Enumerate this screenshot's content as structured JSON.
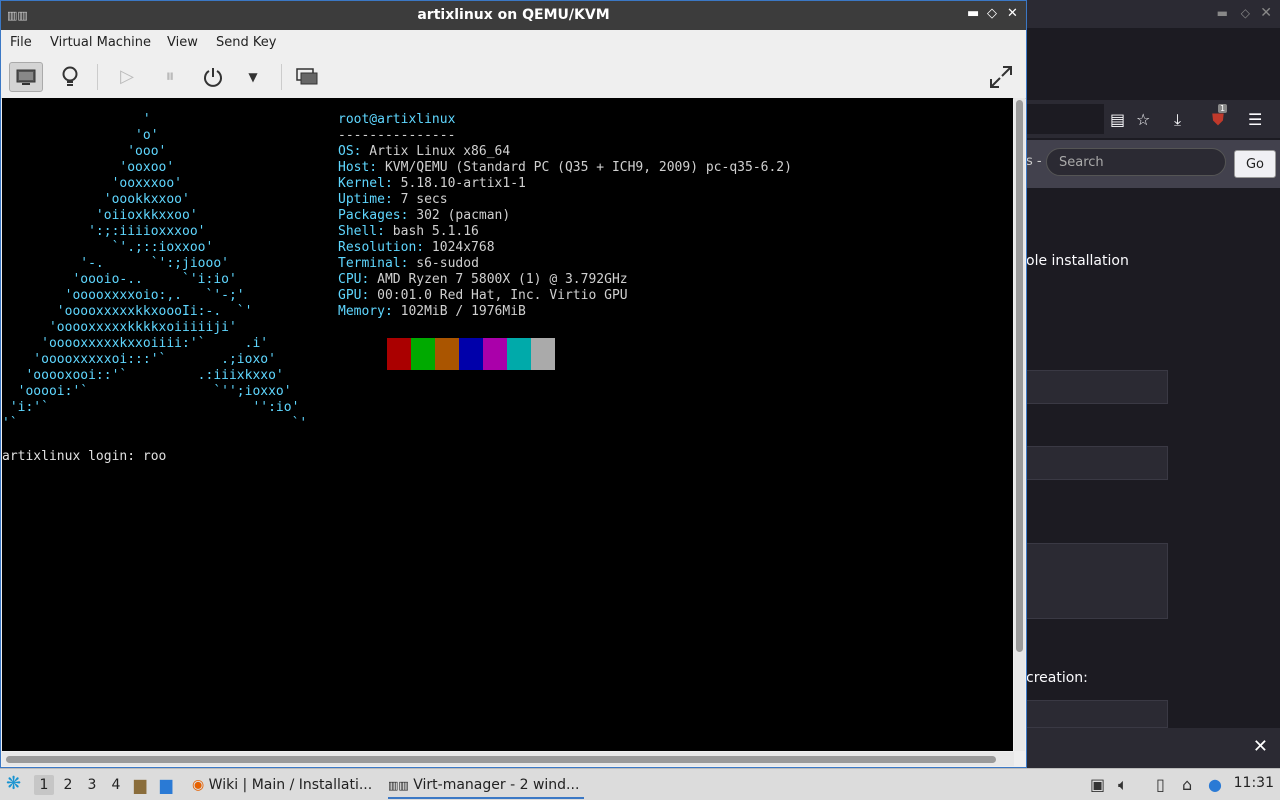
{
  "window": {
    "title": "artixlinux on QEMU/KVM",
    "minimize": "▬",
    "maximize": "◇",
    "close": "✕"
  },
  "menu": {
    "file": "File",
    "virtual_machine": "Virtual Machine",
    "view": "View",
    "send_key": "Send Key"
  },
  "console": {
    "logo_lines": [
      "                  '",
      "                 'o'",
      "                'ooo'",
      "               'ooxoo'",
      "              'ooxxxoo'",
      "             'oookkxxoo'",
      "            'oiioxkkxxoo'",
      "           ':;:iiiioxxxoo'",
      "              `'.;::ioxxoo'",
      "          '-.      `':;jiooo'",
      "         'oooio-..     `'i:io'",
      "        'ooooxxxxoio:,.   `'-;'",
      "       'ooooxxxxxkkxoooIi:-.  `'",
      "      'ooooxxxxxkkkkxoiiiiiji'",
      "     'ooooxxxxxkxxoiiii:'`     .i'",
      "    'ooooxxxxxoi:::'`       .;ioxo'",
      "   'ooooxooi::'`         .:iiixkxxo'",
      "  'ooooi:'`                `'';ioxxo'",
      " 'i:'`                          '':io'",
      "'`                                   `'"
    ],
    "user_host": "root@artixlinux",
    "separator": "---------------",
    "info": [
      {
        "key": "OS",
        "value": "Artix Linux x86_64"
      },
      {
        "key": "Host",
        "value": "KVM/QEMU (Standard PC (Q35 + ICH9, 2009) pc-q35-6.2)"
      },
      {
        "key": "Kernel",
        "value": "5.18.10-artix1-1"
      },
      {
        "key": "Uptime",
        "value": "7 secs"
      },
      {
        "key": "Packages",
        "value": "302 (pacman)"
      },
      {
        "key": "Shell",
        "value": "bash 5.1.16"
      },
      {
        "key": "Resolution",
        "value": "1024x768"
      },
      {
        "key": "Terminal",
        "value": "s6-sudod"
      },
      {
        "key": "CPU",
        "value": "AMD Ryzen 7 5800X (1) @ 3.792GHz"
      },
      {
        "key": "GPU",
        "value": "00:01.0 Red Hat, Inc. Virtio GPU"
      },
      {
        "key": "Memory",
        "value": "102MiB / 1976MiB"
      }
    ],
    "swatch_colors": [
      "#000000",
      "#aa0000",
      "#00aa00",
      "#aa5500",
      "#0000aa",
      "#aa00aa",
      "#00aaaa",
      "#aaaaaa"
    ],
    "login_prompt": "artixlinux login: roo"
  },
  "browser_bg": {
    "search_placeholder": "Search",
    "go_label": "Go",
    "search_prefix": "s -",
    "text_installation": "ole installation",
    "text_creation": "creation:",
    "badge": "1"
  },
  "taskbar": {
    "workspaces": [
      "1",
      "2",
      "3",
      "4"
    ],
    "task_firefox": "Wiki | Main / Installati...",
    "task_virt": "Virt-manager - 2 wind...",
    "clock": "11:31"
  }
}
